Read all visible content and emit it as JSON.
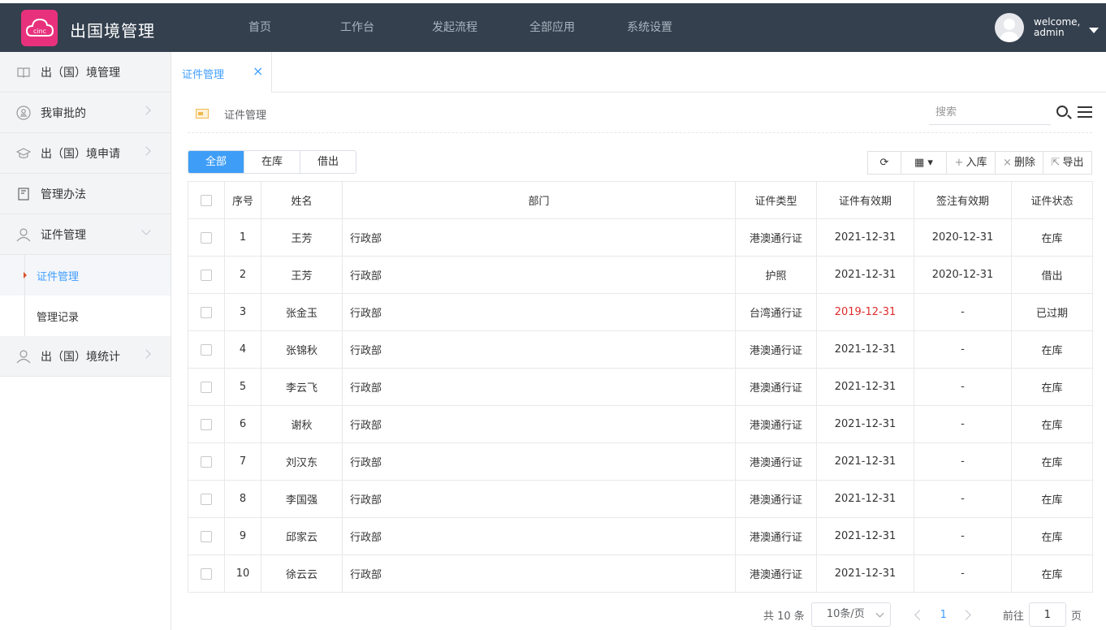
{
  "header": {
    "app_title": "出国境管理",
    "nav": [
      "首页",
      "工作台",
      "发起流程",
      "全部应用",
      "系统设置"
    ],
    "user_welcome": "welcome,",
    "user_name": "admin"
  },
  "sidebar": {
    "items": [
      {
        "label": "出（国）境管理",
        "icon": "book-icon",
        "arrow": "none"
      },
      {
        "label": "我审批的",
        "icon": "stamp-icon",
        "arrow": "right"
      },
      {
        "label": "出（国）境申请",
        "icon": "graduation-cap-icon",
        "arrow": "right"
      },
      {
        "label": "管理办法",
        "icon": "document-icon",
        "arrow": "none"
      },
      {
        "label": "证件管理",
        "icon": "user-icon",
        "arrow": "down"
      }
    ],
    "sub_items": [
      {
        "label": "证件管理",
        "active": true
      },
      {
        "label": "管理记录",
        "active": false
      }
    ],
    "last_item": {
      "label": "出（国）境统计",
      "icon": "user-icon",
      "arrow": "right"
    }
  },
  "tabs": {
    "active_tab": "证件管理",
    "close": "×"
  },
  "breadcrumb": {
    "label": "证件管理"
  },
  "search": {
    "placeholder": "搜索"
  },
  "filter": {
    "all": "全部",
    "in_stock": "在库",
    "borrowed": "借出"
  },
  "toolbar": {
    "refresh": "⟳",
    "columns": "▦ ▾",
    "add": "入库",
    "delete": "删除",
    "export": "导出"
  },
  "table": {
    "columns": [
      "序号",
      "姓名",
      "部门",
      "证件类型",
      "证件有效期",
      "签注有效期",
      "证件状态"
    ],
    "rows": [
      [
        "1",
        "王芳",
        "行政部",
        "港澳通行证",
        "2021-12-31",
        "2020-12-31",
        "在库"
      ],
      [
        "2",
        "王芳",
        "行政部",
        "护照",
        "2021-12-31",
        "2020-12-31",
        "借出"
      ],
      [
        "3",
        "张金玉",
        "行政部",
        "台湾通行证",
        "2019-12-31",
        "-",
        "已过期"
      ],
      [
        "4",
        "张锦秋",
        "行政部",
        "港澳通行证",
        "2021-12-31",
        "-",
        "在库"
      ],
      [
        "5",
        "李云飞",
        "行政部",
        "港澳通行证",
        "2021-12-31",
        "-",
        "在库"
      ],
      [
        "6",
        "谢秋",
        "行政部",
        "港澳通行证",
        "2021-12-31",
        "-",
        "在库"
      ],
      [
        "7",
        "刘汉东",
        "行政部",
        "港澳通行证",
        "2021-12-31",
        "-",
        "在库"
      ],
      [
        "8",
        "李国强",
        "行政部",
        "港澳通行证",
        "2021-12-31",
        "-",
        "在库"
      ],
      [
        "9",
        "邱家云",
        "行政部",
        "港澳通行证",
        "2021-12-31",
        "-",
        "在库"
      ],
      [
        "10",
        "徐云云",
        "行政部",
        "港澳通行证",
        "2021-12-31",
        "-",
        "在库"
      ]
    ]
  },
  "pagination": {
    "total": "共 10 条",
    "page_size": "10条/页",
    "current": "1",
    "goto_label": "前往",
    "goto_value": "1",
    "page_suffix": "页"
  },
  "colors": {
    "brand": "#e8317c",
    "topbar": "#34404e",
    "accent": "#409eff",
    "expired": "#e02b2b"
  }
}
